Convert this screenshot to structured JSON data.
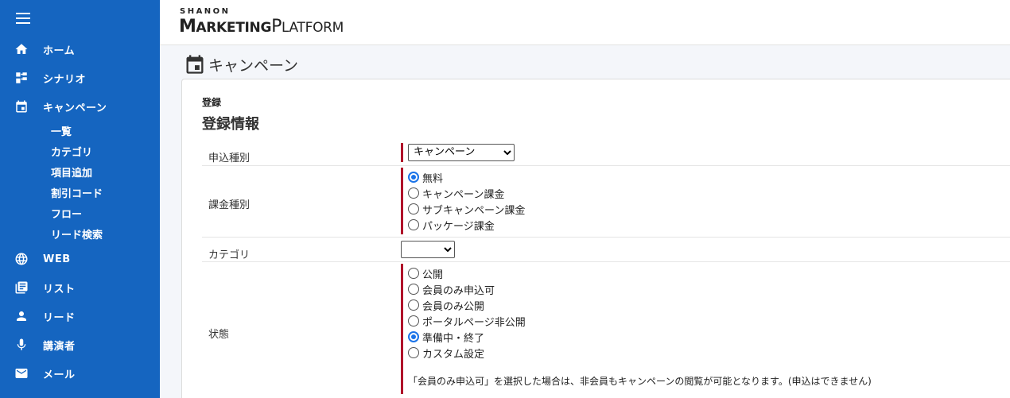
{
  "sidebar": {
    "menu": [
      {
        "label": "ホーム",
        "icon": "home-icon"
      },
      {
        "label": "シナリオ",
        "icon": "scenario-icon"
      },
      {
        "label": "キャンペーン",
        "icon": "calendar-icon"
      },
      {
        "label": "WEB",
        "icon": "globe-icon"
      },
      {
        "label": "リスト",
        "icon": "list-icon"
      },
      {
        "label": "リード",
        "icon": "person-icon"
      },
      {
        "label": "講演者",
        "icon": "mic-icon"
      },
      {
        "label": "メール",
        "icon": "mail-icon"
      }
    ],
    "campaign_sub": [
      "一覧",
      "カテゴリ",
      "項目追加",
      "割引コード",
      "フロー",
      "リード検索"
    ]
  },
  "header": {
    "logo_top": "SHANON",
    "logo_main_1": "M",
    "logo_main_2": "ARKETING",
    "logo_main_3": "P",
    "logo_main_4": "LATFORM"
  },
  "page": {
    "title": "キャンペーン",
    "breadcrumb": "登録",
    "section_title": "登録情報"
  },
  "form": {
    "application_type": {
      "label": "申込種別",
      "value": "キャンペーン"
    },
    "billing_type": {
      "label": "課金種別",
      "options": [
        "無料",
        "キャンペーン課金",
        "サブキャンペーン課金",
        "パッケージ課金"
      ],
      "selected": 0
    },
    "category": {
      "label": "カテゴリ",
      "value": ""
    },
    "status": {
      "label": "状態",
      "options": [
        "公開",
        "会員のみ申込可",
        "会員のみ公開",
        "ポータルページ非公開",
        "準備中・終了",
        "カスタム設定"
      ],
      "selected": 4,
      "note": "「会員のみ申込可」を選択した場合は、非会員もキャンペーンの閲覧が可能となります。(申込はできません)"
    }
  },
  "colors": {
    "sidebar": "#1565c0",
    "required_bar": "#b0122a",
    "radio_selected": "#1a73e8"
  }
}
